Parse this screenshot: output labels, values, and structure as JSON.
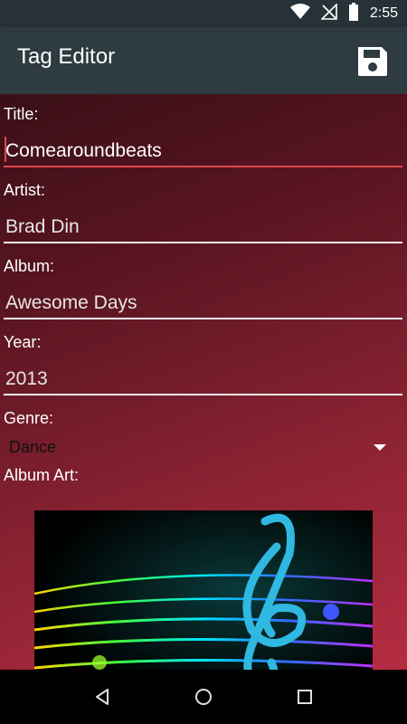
{
  "status_bar": {
    "time": "2:55",
    "icons": [
      "wifi-icon",
      "no-signal-icon",
      "battery-icon"
    ]
  },
  "app_bar": {
    "title": "Tag Editor",
    "save_icon": "save-icon"
  },
  "form": {
    "title_label": "Title:",
    "title_value": "Comearoundbeats",
    "artist_label": "Artist:",
    "artist_value": "Brad Din",
    "album_label": "Album:",
    "album_value": "Awesome Days",
    "year_label": "Year:",
    "year_value": "2013",
    "genre_label": "Genre:",
    "genre_value": "Dance",
    "album_art_label": "Album Art:"
  },
  "nav_bar": {
    "icons": [
      "back-icon",
      "home-icon",
      "recents-icon"
    ]
  },
  "colors": {
    "app_bar": "#2e3b41",
    "accent": "#e0474f",
    "gradient_start": "#3a0f17",
    "gradient_end": "#b52c42"
  }
}
